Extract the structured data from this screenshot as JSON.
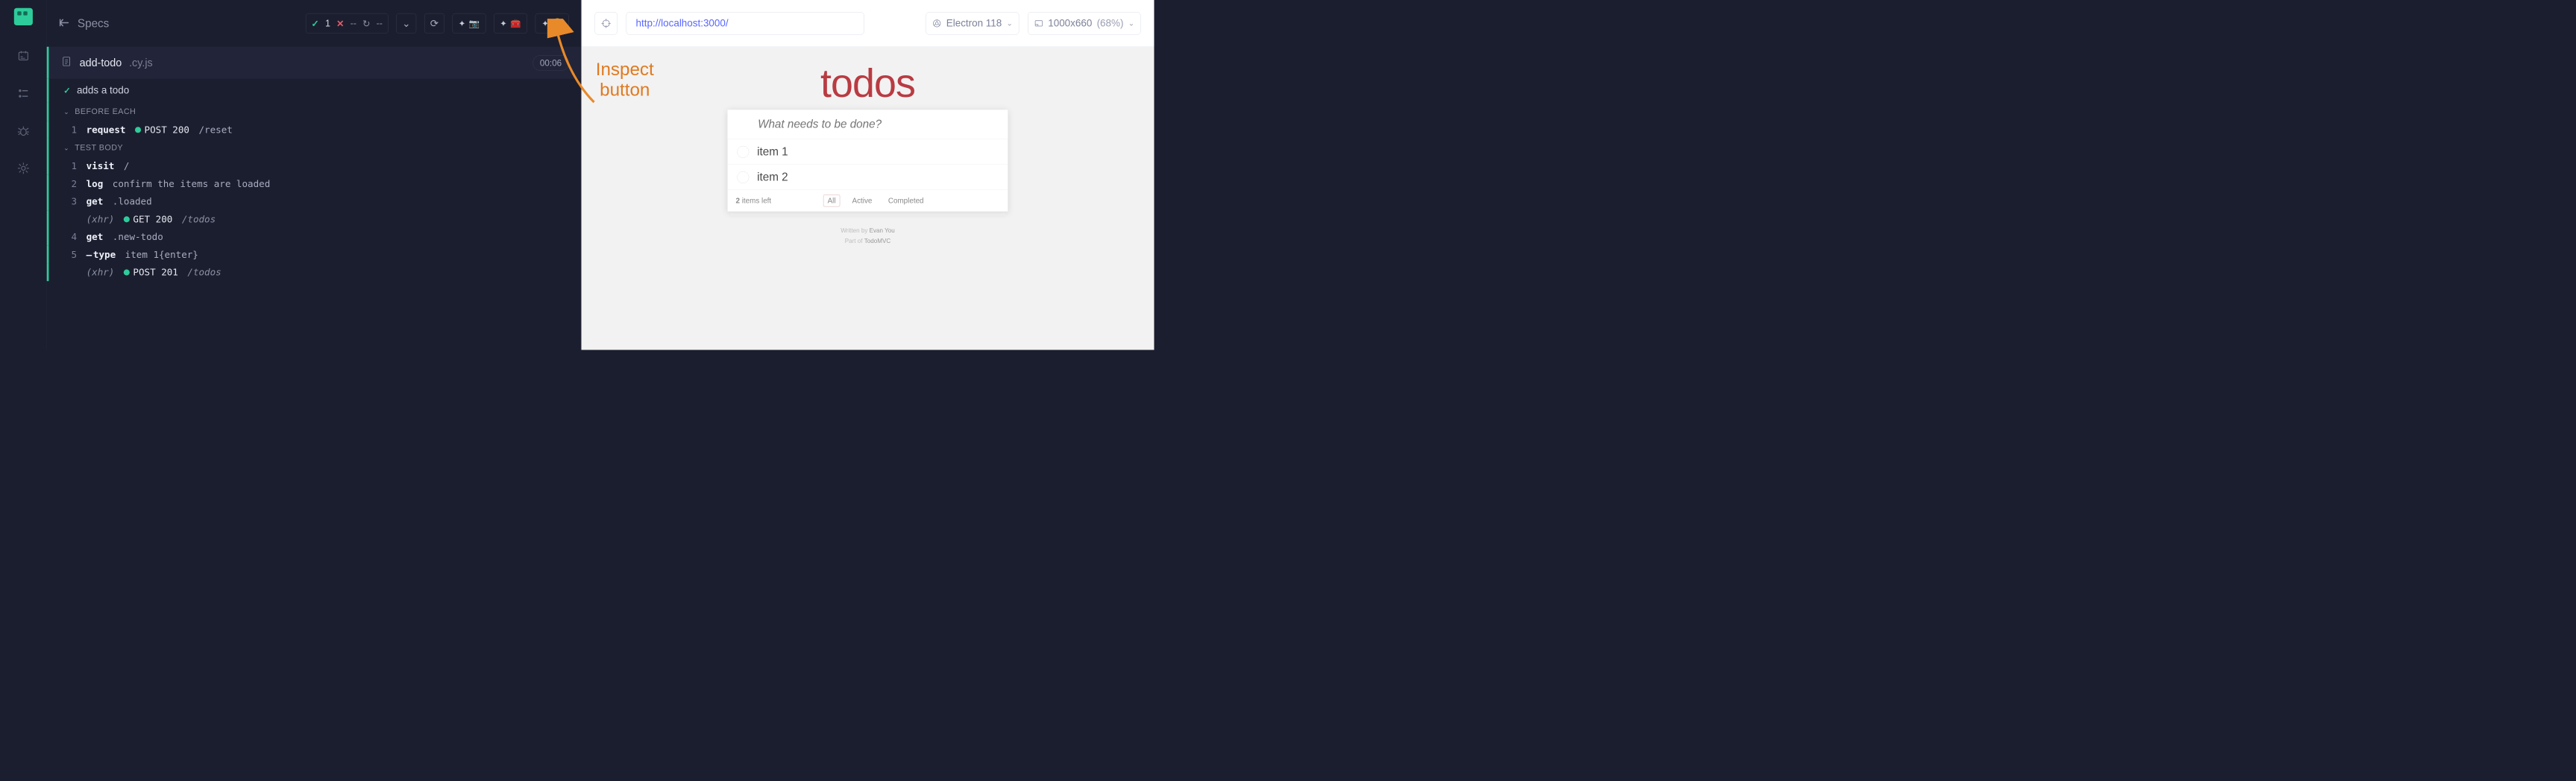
{
  "sidebar": {
    "logo": "cypress-logo"
  },
  "header": {
    "specs_label": "Specs",
    "pass_count": "1",
    "fail_count": "--"
  },
  "spec_file": {
    "name": "add-todo",
    "ext": ".cy.js",
    "duration": "00:06"
  },
  "test": {
    "title": "adds a todo",
    "sections": [
      {
        "label": "BEFORE EACH"
      },
      {
        "label": "TEST BODY"
      }
    ],
    "before_each": [
      {
        "n": "1",
        "cmd": "request",
        "pill": "POST 200",
        "args": "/reset"
      }
    ],
    "body": [
      {
        "n": "1",
        "cmd": "visit",
        "args": "/"
      },
      {
        "n": "2",
        "cmd": "log",
        "args": "confirm the items are loaded"
      },
      {
        "n": "3",
        "cmd": "get",
        "args": ".loaded"
      },
      {
        "n": "",
        "cmd_xhr": "(xhr)",
        "pill": "GET 200",
        "args": "/todos"
      },
      {
        "n": "4",
        "cmd": "get",
        "args": ".new-todo"
      },
      {
        "n": "5",
        "cmd": "type",
        "typed": true,
        "args": "item 1{enter}"
      },
      {
        "n": "",
        "cmd_xhr": "(xhr)",
        "pill": "POST 201",
        "args": "/todos"
      }
    ]
  },
  "annotation": {
    "line1": "Inspect",
    "line2": "button"
  },
  "preview": {
    "url": "http://localhost:3000/",
    "browser": "Electron 118",
    "viewport": "1000x660",
    "scale": "(68%)"
  },
  "todo": {
    "title": "todos",
    "placeholder": "What needs to be done?",
    "items": [
      "item 1",
      "item 2"
    ],
    "count_num": "2",
    "count_label": " items left",
    "filters": [
      "All",
      "Active",
      "Completed"
    ],
    "credits_prefix": "Written by ",
    "credits_author": "Evan You",
    "credits_prefix2": "Part of ",
    "credits_project": "TodoMVC"
  }
}
